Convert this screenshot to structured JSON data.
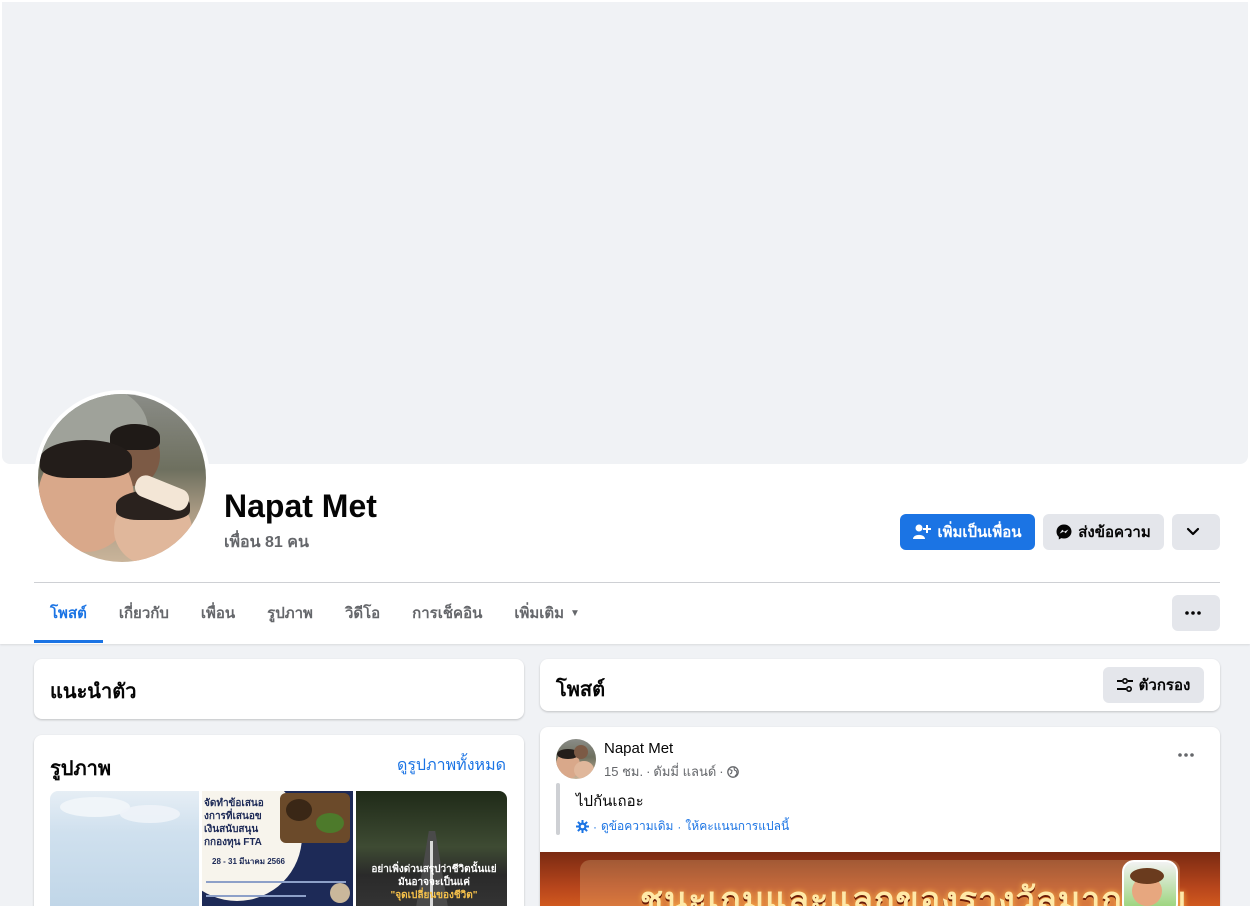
{
  "profile": {
    "name": "Napat Met",
    "friends": "เพื่อน 81 คน"
  },
  "actions": {
    "add_friend": "เพิ่มเป็นเพื่อน",
    "message": "ส่งข้อความ"
  },
  "tabs": [
    {
      "label": "โพสต์"
    },
    {
      "label": "เกี่ยวกับ"
    },
    {
      "label": "เพื่อน"
    },
    {
      "label": "รูปภาพ"
    },
    {
      "label": "วิดีโอ"
    },
    {
      "label": "การเช็คอิน"
    },
    {
      "label": "เพิ่มเติม"
    }
  ],
  "intro": {
    "title": "แนะนำตัว"
  },
  "photos": {
    "title": "รูปภาพ",
    "see_all": "ดูรูปภาพทั้งหมด",
    "photo2_lines": [
      "จัดทำข้อเสนอ",
      "งการที่เสนอข",
      "เงินสนับสนุน",
      "กกองทุน FTA",
      "28 - 31 มีนาคม 2566"
    ],
    "photo3_lines": [
      "อย่าเพิ่งด่วนสรุปว่าชีวิตนั้นแย่",
      "มันอาจจะเป็นแค่",
      "\"จุดเปลี่ยนของชีวิต\""
    ]
  },
  "posts_header": {
    "title": "โพสต์",
    "filter": "ตัวกรอง"
  },
  "post": {
    "author": "Napat Met",
    "time": "15 ชม.",
    "location": "ดัมมี่ แลนด์",
    "text": "ไปกันเถอะ",
    "see_original": "ดูข้อความเดิม",
    "rate_translation": "ให้คะแนนการแปลนี้",
    "banner_text": "ชนะเกมและแลกของรางวัลมากมาย"
  },
  "colors": {
    "accent": "#1b74e4",
    "page_bg": "#f0f2f5",
    "secondary_button": "#e4e6eb",
    "muted_text": "#65676b"
  }
}
